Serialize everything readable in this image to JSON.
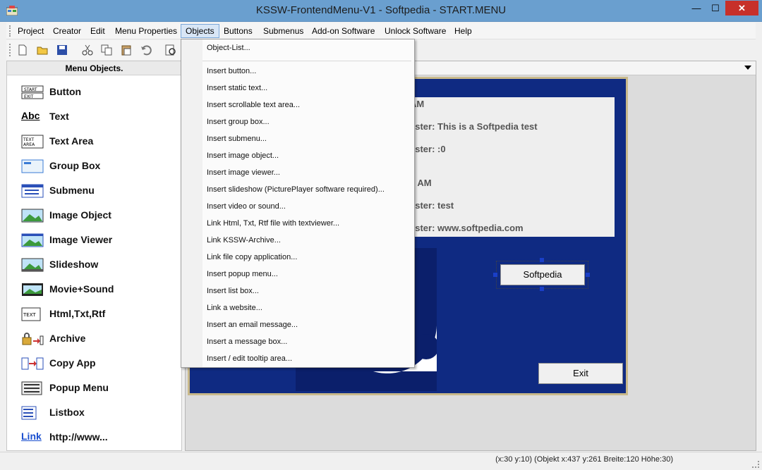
{
  "window": {
    "title": "KSSW-FrontendMenu-V1  -  Softpedia  -  START.MENU",
    "minimize": "—",
    "maximize": "☐",
    "close": "✕"
  },
  "menubar": {
    "items": [
      "Project",
      "Creator",
      "Edit",
      "Menu Properties",
      "Objects",
      "Buttons",
      "Submenus",
      "Add-on Software",
      "Unlock Software",
      "Help"
    ],
    "open_item": "Objects"
  },
  "left_panel": {
    "title": "Menu Objects.",
    "items": [
      {
        "label": "Button",
        "icon": "start-exit-button-icon",
        "icon_text": "START EXIT"
      },
      {
        "label": "Text",
        "icon": "abc-text-icon",
        "icon_text": "Abc"
      },
      {
        "label": "Text Area",
        "icon": "text-area-icon",
        "icon_text": "TEXT AREA"
      },
      {
        "label": "Group Box",
        "icon": "group-box-icon",
        "icon_text": ""
      },
      {
        "label": "Submenu",
        "icon": "submenu-icon",
        "icon_text": ""
      },
      {
        "label": "Image Object",
        "icon": "image-object-icon",
        "icon_text": ""
      },
      {
        "label": "Image Viewer",
        "icon": "image-viewer-icon",
        "icon_text": ""
      },
      {
        "label": "Slideshow",
        "icon": "slideshow-icon",
        "icon_text": ""
      },
      {
        "label": "Movie+Sound",
        "icon": "movie-sound-icon",
        "icon_text": ""
      },
      {
        "label": "Html,Txt,Rtf",
        "icon": "text-file-icon",
        "icon_text": "TEXT"
      },
      {
        "label": "Archive",
        "icon": "archive-lock-icon",
        "icon_text": ""
      },
      {
        "label": "Copy App",
        "icon": "copy-app-icon",
        "icon_text": ""
      },
      {
        "label": "Popup Menu",
        "icon": "popup-menu-icon",
        "icon_text": ""
      },
      {
        "label": "Listbox",
        "icon": "listbox-icon",
        "icon_text": ""
      },
      {
        "label": "http://www...",
        "icon": "link-icon",
        "icon_text": "Link"
      }
    ]
  },
  "objects_menu": {
    "items": [
      "Object-List...",
      "Insert button...",
      "Insert static text...",
      "Insert scrollable text area...",
      "Insert group box...",
      "Insert submenu...",
      "Insert image object...",
      "Insert image viewer...",
      "Insert slideshow (PicturePlayer software required)...",
      "Insert video or sound...",
      "Link Html, Txt, Rtf file with textviewer...",
      "Link KSSW-Archive...",
      "Link file copy application...",
      "Insert popup menu...",
      "Insert list box...",
      "Link a website...",
      "Insert an email message...",
      "Insert a message box...",
      "Insert / edit tooltip area..."
    ]
  },
  "canvas": {
    "text_lines": [
      "AM",
      "ester: This is a Softpedia test",
      "ester: :0",
      "5 AM",
      "ester: test",
      "ester: www.softpedia.com"
    ],
    "softpedia_button": "Softpedia",
    "exit_button": "Exit"
  },
  "toolbar_icons": [
    "new-file-icon",
    "open-folder-icon",
    "save-icon",
    "cut-icon",
    "copy-icon",
    "paste-icon",
    "undo-icon",
    "preview-icon"
  ],
  "statusbar": {
    "text": "(x:30 y:10) (Objekt x:437 y:261 Breite:120 Höhe:30)"
  },
  "colors": {
    "titlebar": "#6a9fcf",
    "canvas_background": "#0f2a82",
    "close_button": "#c7302a",
    "menu_highlight": "#d8e6f6"
  }
}
